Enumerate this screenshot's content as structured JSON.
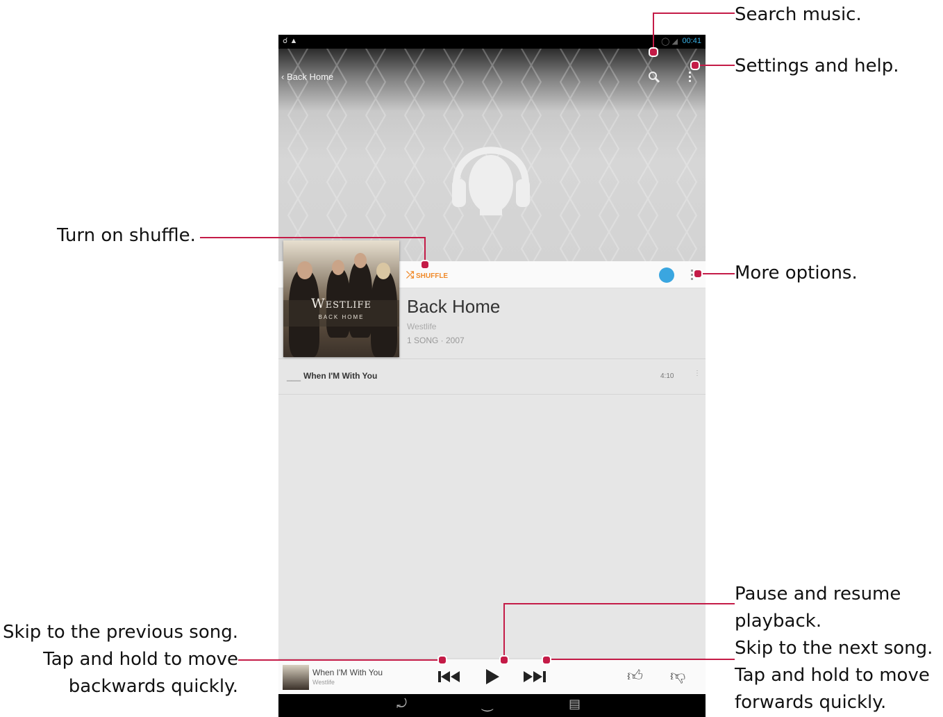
{
  "callouts": {
    "search": "Search music.",
    "settings": "Settings and help.",
    "shuffle": "Turn on shuffle.",
    "more_options": "More options.",
    "previous_line1": "Skip to the previous song.",
    "previous_line2": "Tap and hold to move",
    "previous_line3": "backwards quickly.",
    "pause_line1": "Pause and resume",
    "pause_line2": "playback.",
    "next_line1": "Skip to the next song.",
    "next_line2": "Tap and hold to move",
    "next_line3": "forwards quickly."
  },
  "status_bar": {
    "time": "00:41"
  },
  "top_bar": {
    "back_label": "Back Home",
    "search_icon": "search-icon",
    "menu_icon": "overflow-menu-icon"
  },
  "album": {
    "cover_band": "Westlife",
    "cover_title": "BACK HOME",
    "title": "Back Home",
    "artist": "Westlife",
    "meta": "1 SONG  ·  2007",
    "shuffle_label": "SHUFFLE"
  },
  "tracks": [
    {
      "number": "___",
      "title": "When I'M With You",
      "duration": "4:10"
    }
  ],
  "player": {
    "song": "When I'M With You",
    "artist": "Westlife"
  },
  "colors": {
    "accent": "#c41b47",
    "shuffle": "#f08a2a",
    "status_blue": "#39b3e8",
    "dot_blue": "#3aa6e0"
  }
}
